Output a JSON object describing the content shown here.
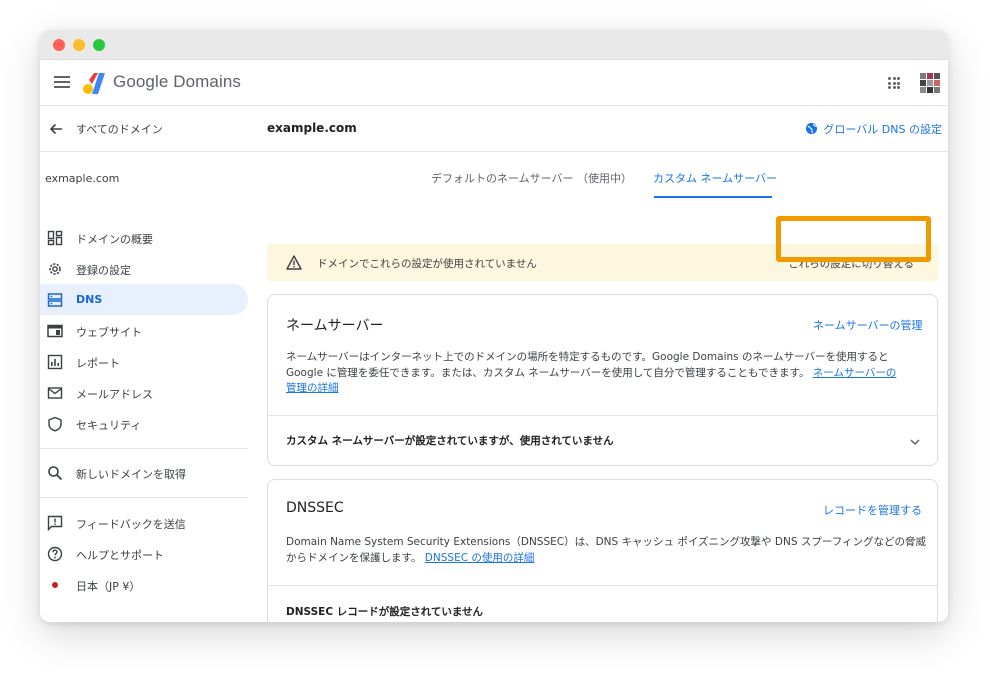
{
  "app": {
    "brand": "Google Domains",
    "colors": {
      "accent": "#1a73e8",
      "highlight": "#f29900",
      "warning_bg": "#fef7e0"
    }
  },
  "sidebar": {
    "back_label": "すべてのドメイン",
    "domain": "exmaple.com",
    "items": [
      {
        "label": "ドメインの概要",
        "icon": "dashboard-icon"
      },
      {
        "label": "登録の設定",
        "icon": "gear-icon"
      },
      {
        "label": "DNS",
        "icon": "dns-icon",
        "active": true
      },
      {
        "label": "ウェブサイト",
        "icon": "website-icon"
      },
      {
        "label": "レポート",
        "icon": "report-icon"
      },
      {
        "label": "メールアドレス",
        "icon": "mail-icon"
      },
      {
        "label": "セキュリティ",
        "icon": "shield-icon"
      }
    ],
    "search_item": {
      "label": "新しいドメインを取得",
      "icon": "search-icon"
    },
    "footer_items": [
      {
        "label": "フィードバックを送信",
        "icon": "feedback-icon"
      },
      {
        "label": "ヘルプとサポート",
        "icon": "help-icon"
      },
      {
        "label": "日本（JP ¥）",
        "icon": "red-dot-icon"
      }
    ]
  },
  "main": {
    "title": "example.com",
    "global_dns_label": "グローバル DNS の設定",
    "tabs": [
      {
        "label": "デフォルトのネームサーバー （使用中）"
      },
      {
        "label": "カスタム ネームサーバー",
        "active": true
      }
    ],
    "warning": {
      "text": "ドメインでこれらの設定が使用されていません",
      "action": "これらの設定に切り替える"
    },
    "nameservers": {
      "title": "ネームサーバー",
      "action": "ネームサーバーの管理",
      "desc_line1": "ネームサーバーはインターネット上でのドメインの場所を特定するものです。Google Domains のネームサーバーを使用すると",
      "desc_line2": "Google に管理を委任できます。または、カスタム ネームサーバーを使用して自分で管理することもできます。",
      "link_part1": "ネームサーバーの",
      "link_part2": "管理の詳細",
      "status": "カスタム ネームサーバーが設定されていますが、使用されていません"
    },
    "dnssec": {
      "title": "DNSSEC",
      "action": "レコードを管理する",
      "desc_line1": "Domain Name System Security Extensions（DNSSEC）は、DNS キャッシュ ポイズニング攻撃や DNS スプーフィングなどの脅威",
      "desc_line2": "からドメインを保護します。",
      "link": "DNSSEC の使用の詳細",
      "status": "DNSSEC レコードが設定されていません"
    }
  }
}
